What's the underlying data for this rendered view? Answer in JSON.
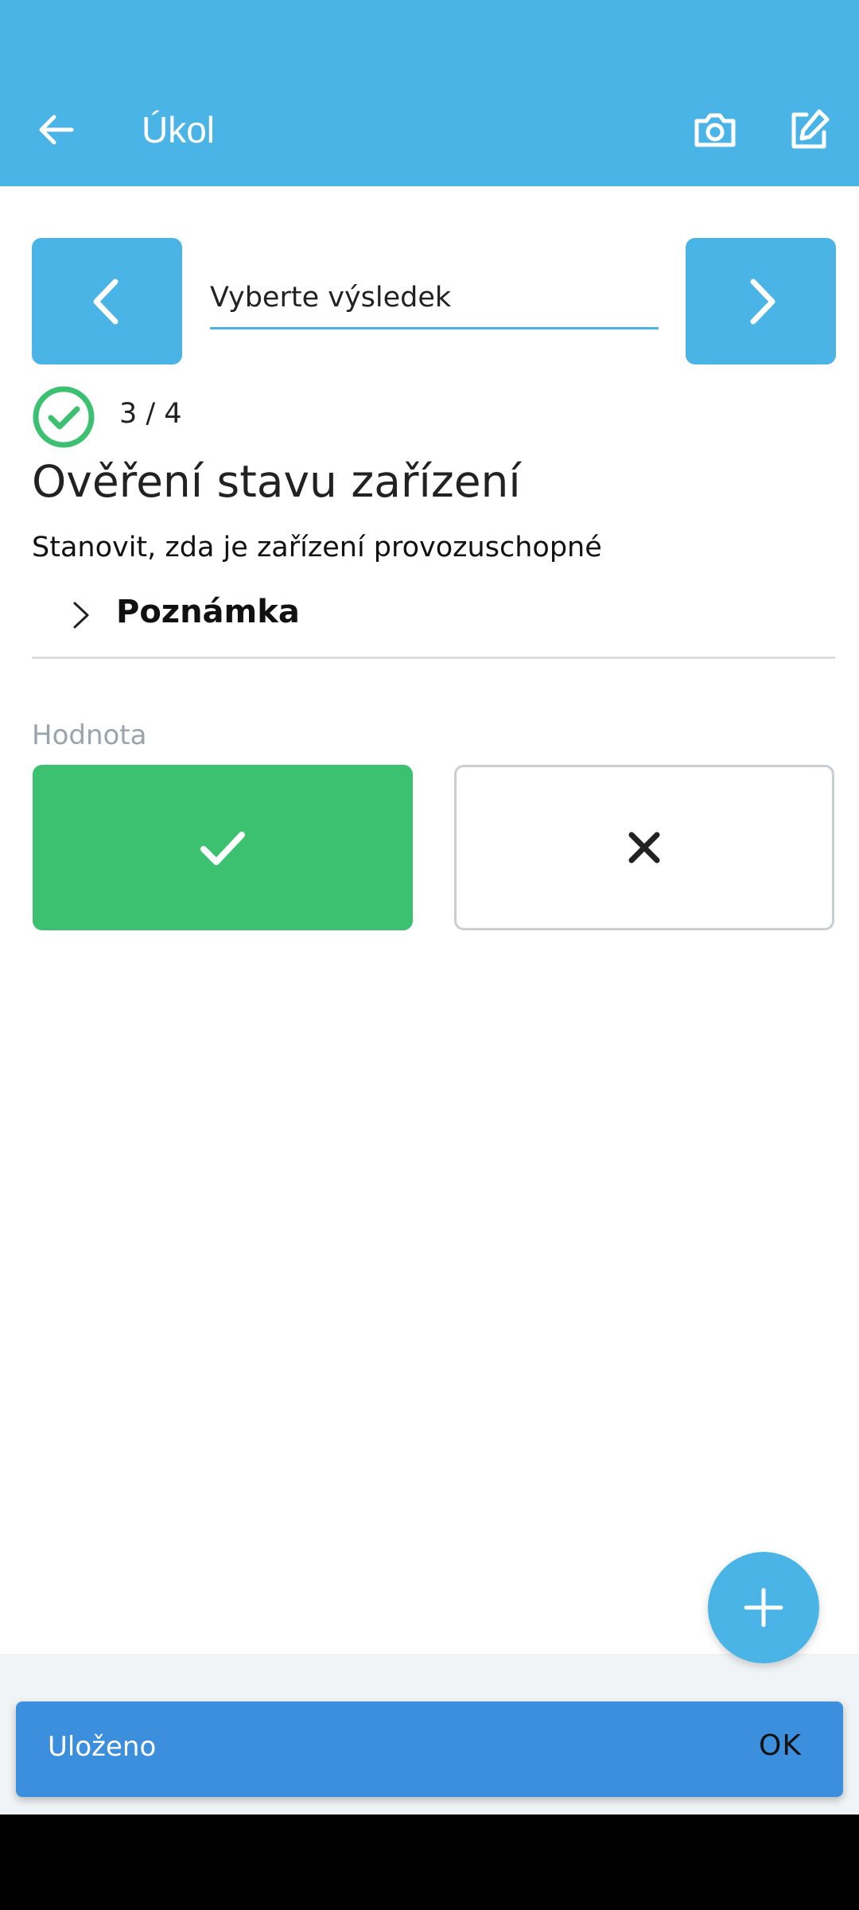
{
  "app_bar": {
    "title": "Úkol",
    "icons": [
      "arrow-left-icon",
      "camera-icon",
      "edit-icon"
    ]
  },
  "result_picker": {
    "placeholder": "Vyberte výsledek"
  },
  "progress": {
    "text": "3 / 4",
    "current": 3,
    "total": 4
  },
  "task": {
    "title": "Ověření stavu zařízení",
    "description": "Stanovit, zda je zařízení provozuschopné"
  },
  "note": {
    "label": "Poznámka"
  },
  "value": {
    "label": "Hodnota",
    "options": [
      {
        "icon": "check-icon",
        "selected": true
      },
      {
        "icon": "close-icon",
        "selected": false
      }
    ]
  },
  "snackbar": {
    "message": "Uloženo",
    "action": "OK"
  },
  "colors": {
    "primary": "#4bb4e6",
    "success": "#3cc170",
    "snackbar": "#3b8fdd"
  }
}
